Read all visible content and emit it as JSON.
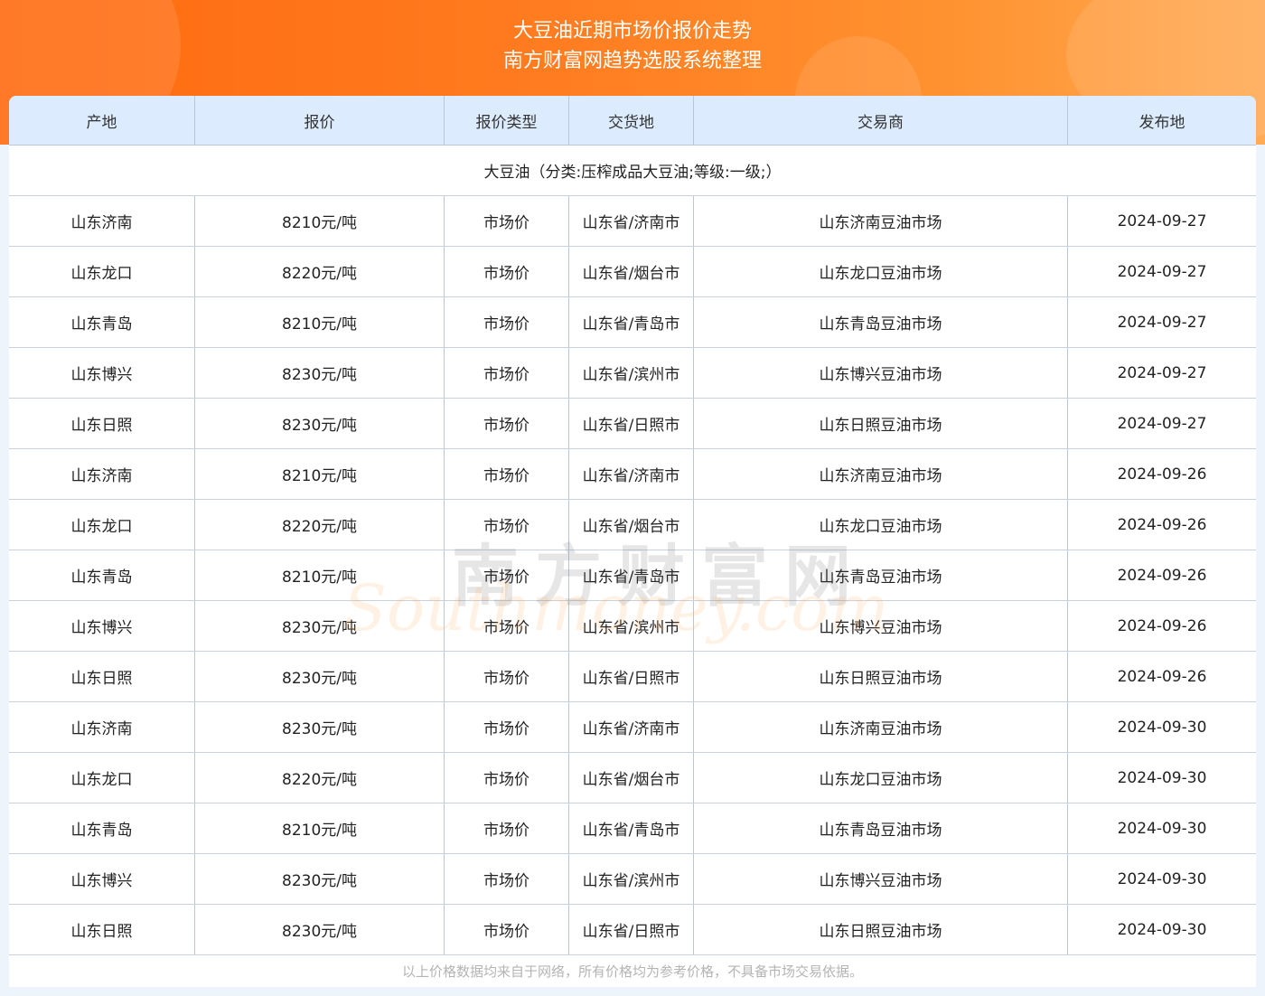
{
  "header": {
    "title": "大豆油近期市场价报价走势",
    "subtitle": "南方财富网趋势选股系统整理"
  },
  "table": {
    "columns": [
      "产地",
      "报价",
      "报价类型",
      "交货地",
      "交易商",
      "发布地"
    ],
    "category": "大豆油（分类:压榨成品大豆油;等级:一级;）",
    "rows": [
      {
        "origin": "山东济南",
        "price": "8210元/吨",
        "price_type": "市场价",
        "delivery": "山东省/济南市",
        "trader": "山东济南豆油市场",
        "date": "2024-09-27"
      },
      {
        "origin": "山东龙口",
        "price": "8220元/吨",
        "price_type": "市场价",
        "delivery": "山东省/烟台市",
        "trader": "山东龙口豆油市场",
        "date": "2024-09-27"
      },
      {
        "origin": "山东青岛",
        "price": "8210元/吨",
        "price_type": "市场价",
        "delivery": "山东省/青岛市",
        "trader": "山东青岛豆油市场",
        "date": "2024-09-27"
      },
      {
        "origin": "山东博兴",
        "price": "8230元/吨",
        "price_type": "市场价",
        "delivery": "山东省/滨州市",
        "trader": "山东博兴豆油市场",
        "date": "2024-09-27"
      },
      {
        "origin": "山东日照",
        "price": "8230元/吨",
        "price_type": "市场价",
        "delivery": "山东省/日照市",
        "trader": "山东日照豆油市场",
        "date": "2024-09-27"
      },
      {
        "origin": "山东济南",
        "price": "8210元/吨",
        "price_type": "市场价",
        "delivery": "山东省/济南市",
        "trader": "山东济南豆油市场",
        "date": "2024-09-26"
      },
      {
        "origin": "山东龙口",
        "price": "8220元/吨",
        "price_type": "市场价",
        "delivery": "山东省/烟台市",
        "trader": "山东龙口豆油市场",
        "date": "2024-09-26"
      },
      {
        "origin": "山东青岛",
        "price": "8210元/吨",
        "price_type": "市场价",
        "delivery": "山东省/青岛市",
        "trader": "山东青岛豆油市场",
        "date": "2024-09-26"
      },
      {
        "origin": "山东博兴",
        "price": "8230元/吨",
        "price_type": "市场价",
        "delivery": "山东省/滨州市",
        "trader": "山东博兴豆油市场",
        "date": "2024-09-26"
      },
      {
        "origin": "山东日照",
        "price": "8230元/吨",
        "price_type": "市场价",
        "delivery": "山东省/日照市",
        "trader": "山东日照豆油市场",
        "date": "2024-09-26"
      },
      {
        "origin": "山东济南",
        "price": "8230元/吨",
        "price_type": "市场价",
        "delivery": "山东省/济南市",
        "trader": "山东济南豆油市场",
        "date": "2024-09-30"
      },
      {
        "origin": "山东龙口",
        "price": "8220元/吨",
        "price_type": "市场价",
        "delivery": "山东省/烟台市",
        "trader": "山东龙口豆油市场",
        "date": "2024-09-30"
      },
      {
        "origin": "山东青岛",
        "price": "8210元/吨",
        "price_type": "市场价",
        "delivery": "山东省/青岛市",
        "trader": "山东青岛豆油市场",
        "date": "2024-09-30"
      },
      {
        "origin": "山东博兴",
        "price": "8230元/吨",
        "price_type": "市场价",
        "delivery": "山东省/滨州市",
        "trader": "山东博兴豆油市场",
        "date": "2024-09-30"
      },
      {
        "origin": "山东日照",
        "price": "8230元/吨",
        "price_type": "市场价",
        "delivery": "山东省/日照市",
        "trader": "山东日照豆油市场",
        "date": "2024-09-30"
      }
    ]
  },
  "footer": {
    "note": "以上价格数据均来自于网络，所有价格均为参考价格，不具备市场交易依据。"
  },
  "watermark": {
    "cn": "南方财富网",
    "en": "Southmoney.com"
  },
  "colors": {
    "banner_start": "#ff6a10",
    "banner_end": "#ffab55",
    "table_header_bg": "#dcebfd",
    "page_bg": "#eef4fb",
    "footer_text": "#b4b4b4"
  }
}
